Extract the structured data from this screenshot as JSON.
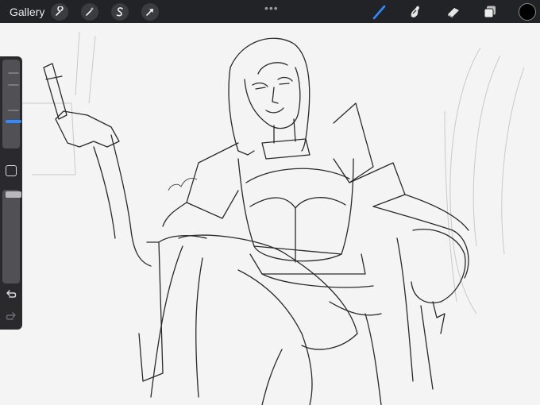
{
  "toolbar": {
    "gallery_label": "Gallery",
    "left_tools": [
      "wrench-icon",
      "magic-wand-icon",
      "selection-icon",
      "transform-arrow-icon"
    ],
    "more_label": "•••",
    "right_tools": [
      "brush-icon",
      "smudge-icon",
      "eraser-icon",
      "layers-icon"
    ],
    "active_tool": "brush",
    "brush_color": "#2f8bff",
    "current_color": "#000000"
  },
  "sidebar": {
    "brush_size_slider": "slider",
    "opacity_slider": "slider",
    "modify_button": "square-icon",
    "undo": "undo-arrow-icon",
    "redo": "redo-arrow-icon"
  }
}
